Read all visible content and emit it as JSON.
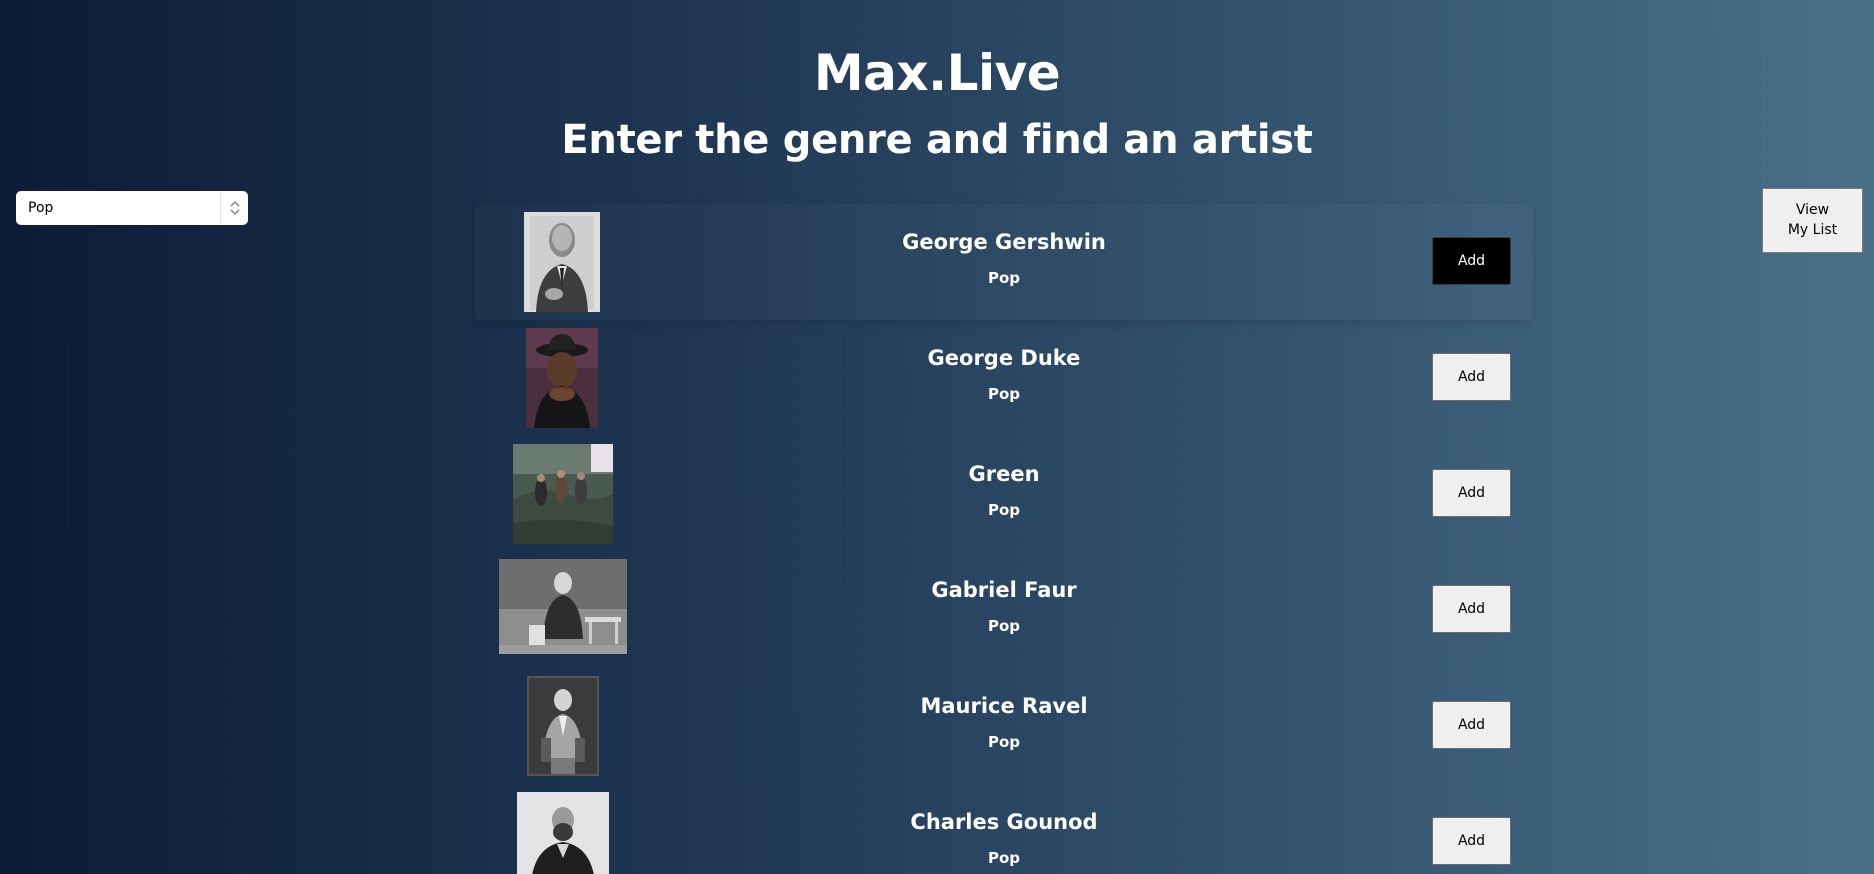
{
  "header": {
    "title": "Max.Live",
    "subtitle": "Enter the genre and find an artist"
  },
  "genre_select": {
    "value": "Pop"
  },
  "view_list_button": {
    "line1": "View",
    "line2": "My List"
  },
  "artists": [
    {
      "name": "George Gershwin",
      "genre": "Pop",
      "add_label": "Add",
      "photo": "black-and-white-portrait"
    },
    {
      "name": "George Duke",
      "genre": "Pop",
      "add_label": "Add",
      "photo": "color-portrait-hat"
    },
    {
      "name": "Green",
      "genre": "Pop",
      "add_label": "Add",
      "photo": "group-outdoor-photo"
    },
    {
      "name": "Gabriel Faur",
      "genre": "Pop",
      "add_label": "Add",
      "photo": "seated-portrait-sepia"
    },
    {
      "name": "Maurice Ravel",
      "genre": "Pop",
      "add_label": "Add",
      "photo": "seated-portrait-bw"
    },
    {
      "name": "Charles Gounod",
      "genre": "Pop",
      "add_label": "Add",
      "photo": "bearded-portrait-bw"
    }
  ],
  "colors": {
    "background_start": "#0d1c35",
    "background_end": "#4a7088",
    "text": "#ffffff",
    "button_bg": "#efefef",
    "active_button_bg": "#000000"
  }
}
